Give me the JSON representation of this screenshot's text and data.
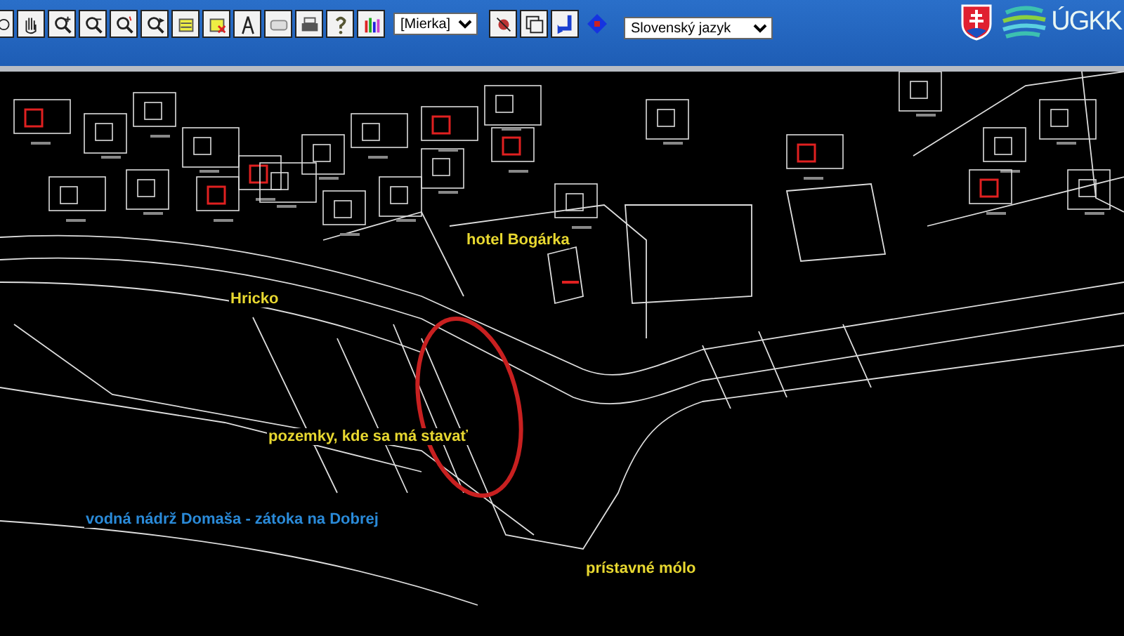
{
  "toolbar": {
    "scale_select": {
      "value": "[Mierka]"
    },
    "language_select": {
      "value": "Slovenský jazyk"
    }
  },
  "header": {
    "logo_text": "ÚGKK"
  },
  "map": {
    "annotations": [
      {
        "text": "hotel Bogárka",
        "color": "#e8d830"
      },
      {
        "text": "Hricko",
        "color": "#e8d830"
      },
      {
        "text": "pozemky, kde sa má stavať",
        "color": "#e8d830"
      },
      {
        "text": "vodná nádrž Domaša - zátoka na Dobrej",
        "color": "#2a8ad8"
      },
      {
        "text": "prístavné mólo",
        "color": "#e8d830"
      }
    ]
  }
}
